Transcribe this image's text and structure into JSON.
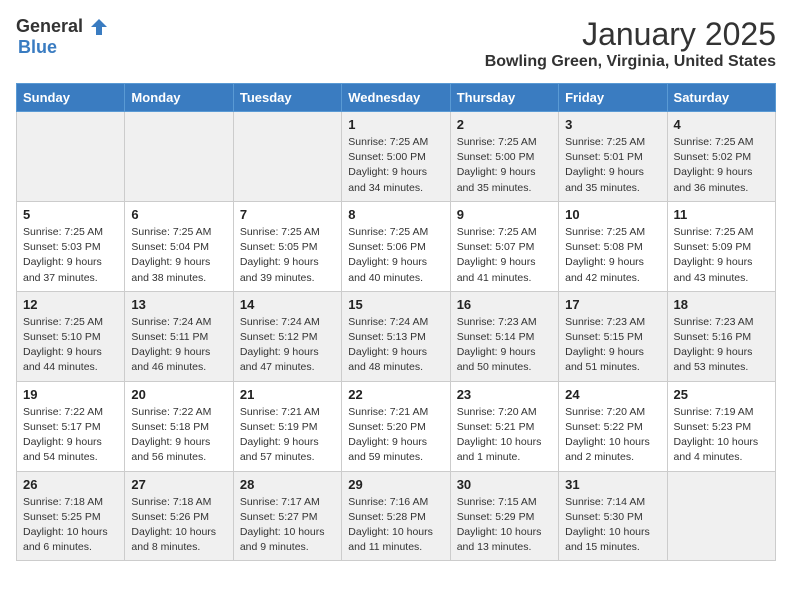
{
  "header": {
    "logo_line1": "General",
    "logo_line2": "Blue",
    "title": "January 2025",
    "subtitle": "Bowling Green, Virginia, United States"
  },
  "days_of_week": [
    "Sunday",
    "Monday",
    "Tuesday",
    "Wednesday",
    "Thursday",
    "Friday",
    "Saturday"
  ],
  "weeks": [
    [
      {
        "day": "",
        "info": ""
      },
      {
        "day": "",
        "info": ""
      },
      {
        "day": "",
        "info": ""
      },
      {
        "day": "1",
        "info": "Sunrise: 7:25 AM\nSunset: 5:00 PM\nDaylight: 9 hours\nand 34 minutes."
      },
      {
        "day": "2",
        "info": "Sunrise: 7:25 AM\nSunset: 5:00 PM\nDaylight: 9 hours\nand 35 minutes."
      },
      {
        "day": "3",
        "info": "Sunrise: 7:25 AM\nSunset: 5:01 PM\nDaylight: 9 hours\nand 35 minutes."
      },
      {
        "day": "4",
        "info": "Sunrise: 7:25 AM\nSunset: 5:02 PM\nDaylight: 9 hours\nand 36 minutes."
      }
    ],
    [
      {
        "day": "5",
        "info": "Sunrise: 7:25 AM\nSunset: 5:03 PM\nDaylight: 9 hours\nand 37 minutes."
      },
      {
        "day": "6",
        "info": "Sunrise: 7:25 AM\nSunset: 5:04 PM\nDaylight: 9 hours\nand 38 minutes."
      },
      {
        "day": "7",
        "info": "Sunrise: 7:25 AM\nSunset: 5:05 PM\nDaylight: 9 hours\nand 39 minutes."
      },
      {
        "day": "8",
        "info": "Sunrise: 7:25 AM\nSunset: 5:06 PM\nDaylight: 9 hours\nand 40 minutes."
      },
      {
        "day": "9",
        "info": "Sunrise: 7:25 AM\nSunset: 5:07 PM\nDaylight: 9 hours\nand 41 minutes."
      },
      {
        "day": "10",
        "info": "Sunrise: 7:25 AM\nSunset: 5:08 PM\nDaylight: 9 hours\nand 42 minutes."
      },
      {
        "day": "11",
        "info": "Sunrise: 7:25 AM\nSunset: 5:09 PM\nDaylight: 9 hours\nand 43 minutes."
      }
    ],
    [
      {
        "day": "12",
        "info": "Sunrise: 7:25 AM\nSunset: 5:10 PM\nDaylight: 9 hours\nand 44 minutes."
      },
      {
        "day": "13",
        "info": "Sunrise: 7:24 AM\nSunset: 5:11 PM\nDaylight: 9 hours\nand 46 minutes."
      },
      {
        "day": "14",
        "info": "Sunrise: 7:24 AM\nSunset: 5:12 PM\nDaylight: 9 hours\nand 47 minutes."
      },
      {
        "day": "15",
        "info": "Sunrise: 7:24 AM\nSunset: 5:13 PM\nDaylight: 9 hours\nand 48 minutes."
      },
      {
        "day": "16",
        "info": "Sunrise: 7:23 AM\nSunset: 5:14 PM\nDaylight: 9 hours\nand 50 minutes."
      },
      {
        "day": "17",
        "info": "Sunrise: 7:23 AM\nSunset: 5:15 PM\nDaylight: 9 hours\nand 51 minutes."
      },
      {
        "day": "18",
        "info": "Sunrise: 7:23 AM\nSunset: 5:16 PM\nDaylight: 9 hours\nand 53 minutes."
      }
    ],
    [
      {
        "day": "19",
        "info": "Sunrise: 7:22 AM\nSunset: 5:17 PM\nDaylight: 9 hours\nand 54 minutes."
      },
      {
        "day": "20",
        "info": "Sunrise: 7:22 AM\nSunset: 5:18 PM\nDaylight: 9 hours\nand 56 minutes."
      },
      {
        "day": "21",
        "info": "Sunrise: 7:21 AM\nSunset: 5:19 PM\nDaylight: 9 hours\nand 57 minutes."
      },
      {
        "day": "22",
        "info": "Sunrise: 7:21 AM\nSunset: 5:20 PM\nDaylight: 9 hours\nand 59 minutes."
      },
      {
        "day": "23",
        "info": "Sunrise: 7:20 AM\nSunset: 5:21 PM\nDaylight: 10 hours\nand 1 minute."
      },
      {
        "day": "24",
        "info": "Sunrise: 7:20 AM\nSunset: 5:22 PM\nDaylight: 10 hours\nand 2 minutes."
      },
      {
        "day": "25",
        "info": "Sunrise: 7:19 AM\nSunset: 5:23 PM\nDaylight: 10 hours\nand 4 minutes."
      }
    ],
    [
      {
        "day": "26",
        "info": "Sunrise: 7:18 AM\nSunset: 5:25 PM\nDaylight: 10 hours\nand 6 minutes."
      },
      {
        "day": "27",
        "info": "Sunrise: 7:18 AM\nSunset: 5:26 PM\nDaylight: 10 hours\nand 8 minutes."
      },
      {
        "day": "28",
        "info": "Sunrise: 7:17 AM\nSunset: 5:27 PM\nDaylight: 10 hours\nand 9 minutes."
      },
      {
        "day": "29",
        "info": "Sunrise: 7:16 AM\nSunset: 5:28 PM\nDaylight: 10 hours\nand 11 minutes."
      },
      {
        "day": "30",
        "info": "Sunrise: 7:15 AM\nSunset: 5:29 PM\nDaylight: 10 hours\nand 13 minutes."
      },
      {
        "day": "31",
        "info": "Sunrise: 7:14 AM\nSunset: 5:30 PM\nDaylight: 10 hours\nand 15 minutes."
      },
      {
        "day": "",
        "info": ""
      }
    ]
  ],
  "shaded_rows": [
    0,
    2,
    4
  ],
  "empty_cells": {
    "0": [
      0,
      1,
      2
    ],
    "4": [
      6
    ]
  }
}
